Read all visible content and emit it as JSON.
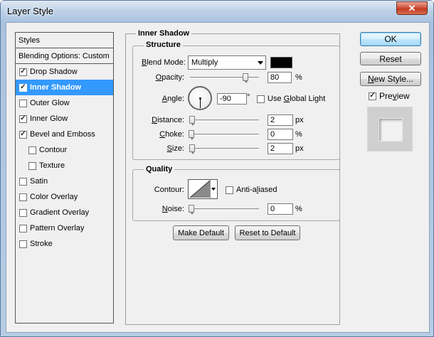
{
  "window": {
    "title": "Layer Style",
    "close_glyph": "✕"
  },
  "sidebar": {
    "header": "Styles",
    "blending": "Blending Options: Custom",
    "items": [
      {
        "label": "Drop Shadow",
        "checked": true,
        "selected": false,
        "sub": false
      },
      {
        "label": "Inner Shadow",
        "checked": true,
        "selected": true,
        "sub": false
      },
      {
        "label": "Outer Glow",
        "checked": false,
        "selected": false,
        "sub": false
      },
      {
        "label": "Inner Glow",
        "checked": true,
        "selected": false,
        "sub": false
      },
      {
        "label": "Bevel and Emboss",
        "checked": true,
        "selected": false,
        "sub": false
      },
      {
        "label": "Contour",
        "checked": false,
        "selected": false,
        "sub": true
      },
      {
        "label": "Texture",
        "checked": false,
        "selected": false,
        "sub": true
      },
      {
        "label": "Satin",
        "checked": false,
        "selected": false,
        "sub": false
      },
      {
        "label": "Color Overlay",
        "checked": false,
        "selected": false,
        "sub": false
      },
      {
        "label": "Gradient Overlay",
        "checked": false,
        "selected": false,
        "sub": false
      },
      {
        "label": "Pattern Overlay",
        "checked": false,
        "selected": false,
        "sub": false
      },
      {
        "label": "Stroke",
        "checked": false,
        "selected": false,
        "sub": false
      }
    ]
  },
  "panel": {
    "title": "Inner Shadow",
    "structure": {
      "legend": "Structure",
      "blend_mode_label_u": "B",
      "blend_mode_label_rest": "lend Mode:",
      "blend_mode_value": "Multiply",
      "color": "#000000",
      "opacity_label_u": "O",
      "opacity_label_rest": "pacity:",
      "opacity_value": "80",
      "opacity_unit": "%",
      "opacity_level": 0.8,
      "angle_label_u": "A",
      "angle_label_rest": "ngle:",
      "angle_value": "-90",
      "angle_unit": "°",
      "global_light_pre": "Use ",
      "global_light_u": "G",
      "global_light_rest": "lobal Light",
      "distance_label_u": "D",
      "distance_label_rest": "istance:",
      "distance_value": "2",
      "distance_unit": "px",
      "choke_label_u": "C",
      "choke_label_rest": "hoke:",
      "choke_value": "0",
      "choke_unit": "%",
      "size_label_u": "S",
      "size_label_rest": "ize:",
      "size_value": "2",
      "size_unit": "px"
    },
    "quality": {
      "legend": "Quality",
      "contour_label": "Contour:",
      "anti_aliased_pre": "Anti-a",
      "anti_aliased_u": "l",
      "anti_aliased_rest": "iased",
      "noise_label_u": "N",
      "noise_label_rest": "oise:",
      "noise_value": "0",
      "noise_unit": "%"
    },
    "make_default": "Make Default",
    "reset_to_default": "Reset to Default"
  },
  "actions": {
    "ok": "OK",
    "reset": "Reset",
    "new_style_u": "N",
    "new_style_rest": "ew Style...",
    "preview_pre": "Pre",
    "preview_u": "v",
    "preview_rest": "iew",
    "preview_checked": true
  },
  "colors": {
    "selection": "#3399ff",
    "swatch": "#000000"
  }
}
